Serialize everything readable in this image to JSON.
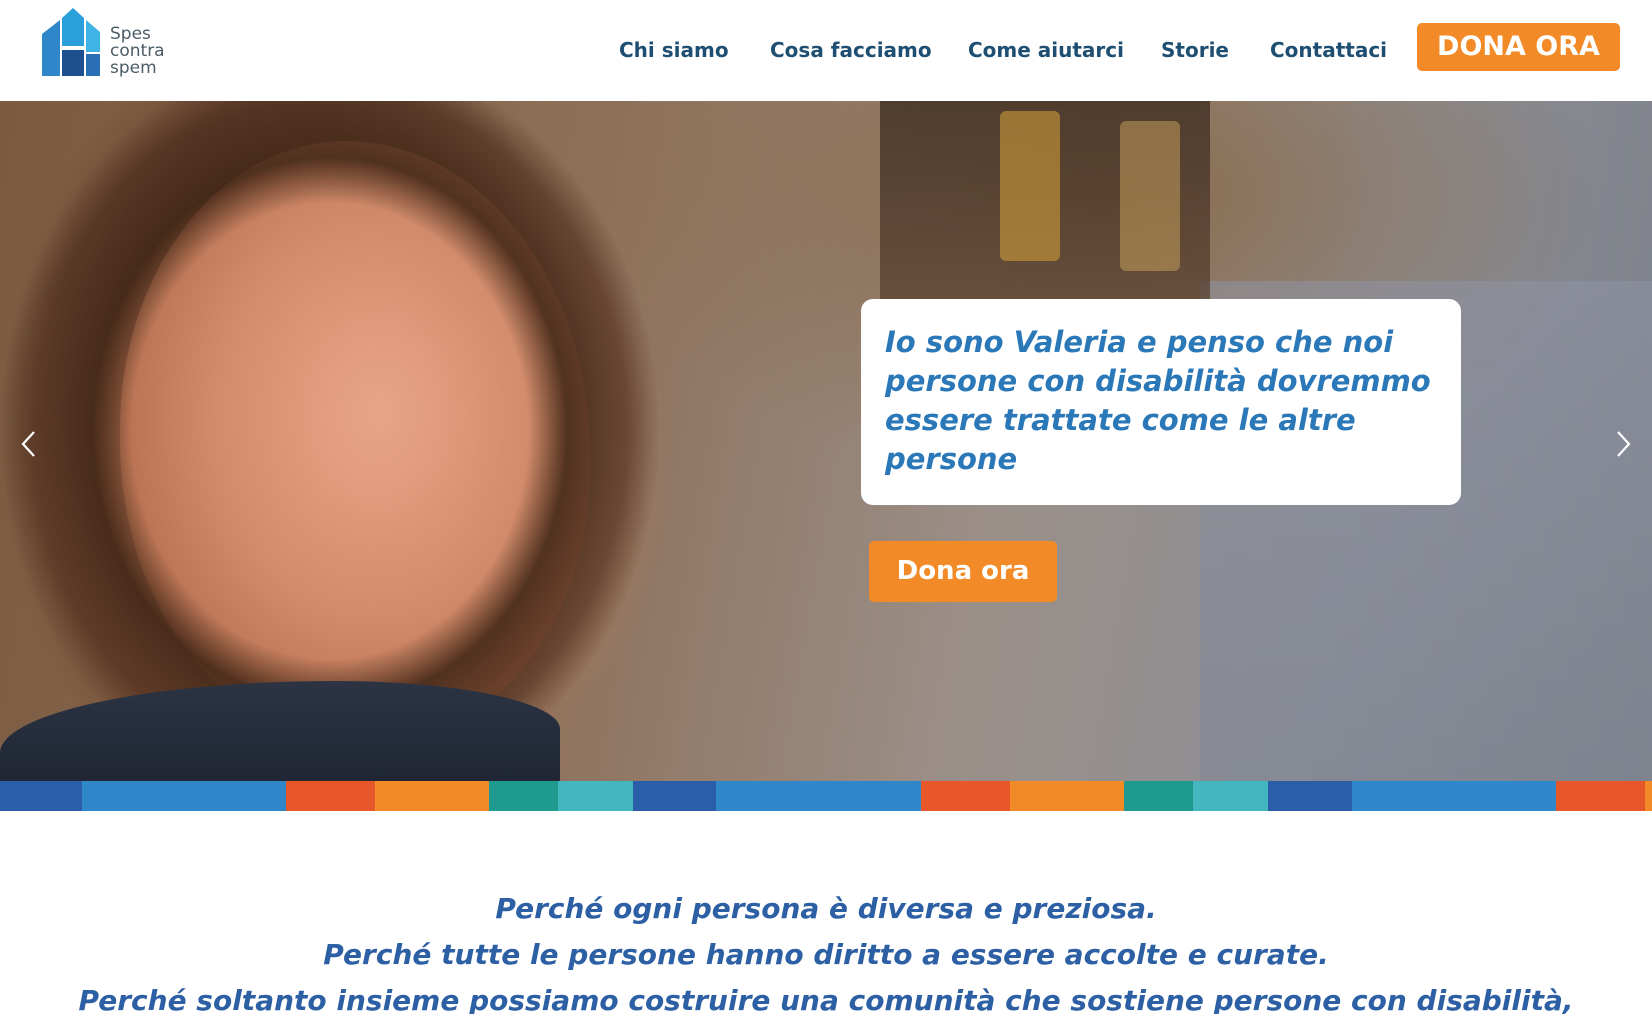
{
  "brand": {
    "logo_line1": "Spes",
    "logo_line2": "contra",
    "logo_line3": "spem",
    "colors": {
      "primary_blue": "#1e4f72",
      "accent_orange": "#f28a27",
      "quote_blue": "#2b78b8",
      "mission_blue": "#2c5fa3"
    }
  },
  "nav": {
    "items": [
      "Chi siamo",
      "Cosa facciamo",
      "Come aiutarci",
      "Storie",
      "Contattaci"
    ],
    "donate_label": "DONA ORA"
  },
  "hero": {
    "quote": "Io sono Valeria e penso che noi persone con disabilità dovremmo essere trattate come le altre persone",
    "donate_label": "Dona ora",
    "prev_icon": "chevron-left-icon",
    "next_icon": "chevron-right-icon"
  },
  "band": {
    "colors": [
      "#2a5ea8",
      "#2f86c9",
      "#e8572a",
      "#f28a27",
      "#1f9a8e",
      "#43b6bf"
    ]
  },
  "mission": {
    "lines": [
      "Perché ogni persona è diversa e preziosa.",
      "Perché tutte le persone hanno diritto a essere accolte e curate.",
      "Perché soltanto insieme possiamo costruire una comunità che sostiene persone con disabilità,"
    ]
  }
}
